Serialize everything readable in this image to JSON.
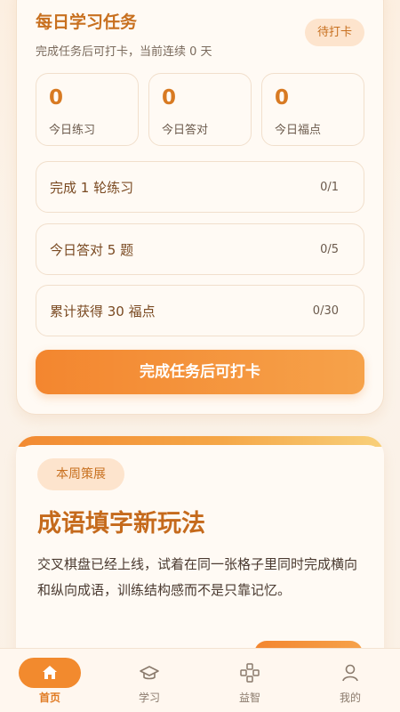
{
  "daily_task": {
    "title": "每日学习任务",
    "subtitle": "完成任务后可打卡，当前连续 0 天",
    "status_badge": "待打卡",
    "stats": [
      {
        "value": "0",
        "label": "今日练习"
      },
      {
        "value": "0",
        "label": "今日答对"
      },
      {
        "value": "0",
        "label": "今日福点"
      }
    ],
    "tasks": [
      {
        "label": "完成 1 轮练习",
        "progress": "0/1"
      },
      {
        "label": "今日答对 5 题",
        "progress": "0/5"
      },
      {
        "label": "累计获得 30 福点",
        "progress": "0/30"
      }
    ],
    "checkin_button": "完成任务后可打卡"
  },
  "feature": {
    "tag": "本周策展",
    "title": "成语填字新玩法",
    "description": "交叉棋盘已经上线，试着在同一张格子里同时完成横向和纵向成语，训练结构感而不是只靠记忆。"
  },
  "tabbar": {
    "items": [
      {
        "label": "首页",
        "icon": "home-icon",
        "active": true
      },
      {
        "label": "学习",
        "icon": "graduation-cap-icon",
        "active": false
      },
      {
        "label": "益智",
        "icon": "gamepad-icon",
        "active": false
      },
      {
        "label": "我的",
        "icon": "user-icon",
        "active": false
      }
    ]
  },
  "colors": {
    "accent": "#f28a2e",
    "title_orange": "#c8701f",
    "background": "#fbf1e6"
  }
}
